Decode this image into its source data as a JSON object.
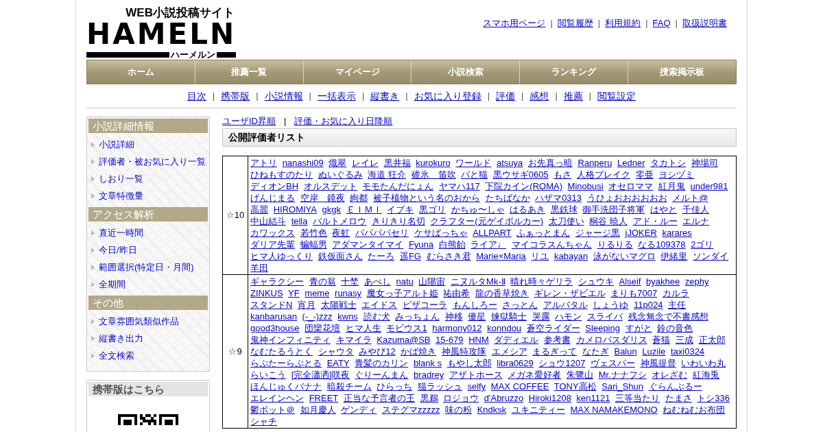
{
  "logo": {
    "tagline": "WEB小説投稿サイト",
    "name": "HAMELN",
    "reading": "ハーメルン"
  },
  "header_links": [
    {
      "label": "スマホ用ページ"
    },
    {
      "sep": "|",
      "label": "閲覧履歴"
    },
    {
      "sep": "|",
      "label": "利用規約"
    },
    {
      "sep": "|",
      "label": "FAQ"
    },
    {
      "sep": "|",
      "label": "取扱説明書"
    }
  ],
  "nav": [
    "ホーム",
    "推薦一覧",
    "マイページ",
    "小説検索",
    "ランキング",
    "捜索掲示板"
  ],
  "sub_nav": [
    {
      "label": "目次"
    },
    {
      "sep": "|",
      "label": "携帯版"
    },
    {
      "sep": "|",
      "label": "小説情報"
    },
    {
      "sep": "|",
      "label": "一括表示"
    },
    {
      "sep": "|",
      "label": "縦書き"
    },
    {
      "sep": "|",
      "label": "お気に入り登録"
    },
    {
      "sep": "|",
      "label": "評価"
    },
    {
      "sep": "|",
      "label": "感想"
    },
    {
      "sep": "|",
      "label": "推薦"
    },
    {
      "sep": "|",
      "label": "閲覧設定"
    }
  ],
  "sidebar": {
    "sections": [
      {
        "title": "小説詳細情報",
        "items": [
          "小説詳細",
          "評価者・被お気に入り一覧",
          "しおり一覧",
          "文章特徴量"
        ]
      },
      {
        "title": "アクセス解析",
        "items": [
          "直近一時間",
          "今日/昨日",
          "範囲選択(特定日・月間)",
          "全期間"
        ]
      },
      {
        "title": "その他",
        "items": [
          "文章雰囲気類似作品",
          "縦書き出力",
          "全文検索"
        ]
      }
    ],
    "mobile_box": {
      "title": "携帯版はこちら"
    }
  },
  "sort_links": [
    {
      "label": "ユーザID昇順"
    },
    {
      "sep": "|",
      "label": "評価・お気に入り日降順"
    }
  ],
  "list_title": "公開評価者リスト",
  "ratings": [
    {
      "rating": "☆10",
      "users": [
        "アトリ",
        "nanashi09",
        "熾翠",
        "レイレ",
        "黒井福",
        "kurokuro",
        "ワールド",
        "atsuya",
        "お先真っ暗",
        "Ranperu",
        "Ledner",
        "タカトシ",
        "神場司",
        "ひねもすのたり",
        "ぬいぐるみ",
        "海道 狂介",
        "碓氷　笛吹",
        "パと猫",
        "黒ウサギ0605",
        "もさ",
        "人格ブレイク",
        "零亜",
        "ヨシヅミ",
        "ディオンBH",
        "オルスデット",
        "モモたんだにょん",
        "ヤマハ117",
        "下院カイン(ROMA)",
        "Minobusi",
        "オセロママ",
        "紅月鬼",
        "under981",
        "げんじまる",
        "空岸　鏡夜",
        "絢都",
        "被子植物という名のおから",
        "たちばなか",
        "ハザマ0313",
        "うひょおおおおおお",
        "メルト@",
        "高麗",
        "HIROMIYA",
        "gkgk",
        "ＥＩＭＩ",
        "イブキ",
        "黒ゴリ",
        "かちゅ〜しゃ",
        "はるあき",
        "黒鉄球",
        "御手洗団子将軍",
        "はやと",
        "千佳人",
        "中山結斗",
        "tella",
        "バルトメロウ",
        "きりきり名切",
        "クラフター(元ゲイボルカー)",
        "太刀使い",
        "桐谷 暁人",
        "アド・ルー",
        "エルナ",
        "カワックス",
        "若竹色",
        "夜虹",
        "パパパパセリ",
        "ケサぱっちゃ",
        "ALLPART",
        "ふぁっとまん",
        "ジャージ黒",
        "jJOKER",
        "karares",
        "ダリア先輩",
        "蝙蝠男",
        "アダマンタイマイ",
        "Fyuna",
        "白熊飴",
        "ライア♩",
        "マイコラスんちゃん",
        "りるりる",
        "なる109378",
        "2ゴリ",
        "ヒマ人ゆっくり",
        "鉄仮面さん",
        "たーろ",
        "遥FG",
        "むらさき君",
        "Marie×Maria",
        "リユ",
        "kabayan",
        "泳がないマグロ",
        "伊緒里",
        "ソンダイ",
        "羊田"
      ]
    },
    {
      "rating": "☆9",
      "users": [
        "ギャラクシー",
        "青の翁",
        "十埜",
        "あべし",
        "natu",
        "山陽宙",
        "ニヌルタMk-Ⅱ",
        "晴れ時々ゲリラ",
        "シュウキ",
        "Alseif",
        "byakhee",
        "zephy",
        "ZINKUS",
        "YF",
        "meme",
        "runasy",
        "魔女っ子アルト姫",
        "祐由希",
        "龍の香草焼き",
        "ギレン・ザビエル",
        "まりも7007",
        "カルラ",
        "スタンドN",
        "宵月",
        "太陽戦士",
        "エイドス",
        "ピザコーラ",
        "もんしろー",
        "さっとん",
        "アルバタル",
        "しょうゆ",
        "11p024",
        "主任",
        "kanbarusan",
        "(-_-)zzz",
        "kwns",
        "読む犬",
        "みっちょん",
        "神移",
        "優星",
        "煉獄騎士",
        "哭露",
        "ハモン",
        "スライバ",
        "残念無念で不書感想",
        "good3house",
        "団欒花壇",
        "ヒマ人生",
        "モビウス1",
        "harmony012",
        "konndou",
        "蒼空ライダー",
        "Sleeping",
        "すがと",
        "鈴の音色",
        "鬼神インフィニティ",
        "キマイラ",
        "Kazuma@SB",
        "15-679",
        "HNM",
        "ダディエル",
        "参考書",
        "カメロパスダリス",
        "蒼猫",
        "三成",
        "正太郎",
        "なむたるうとく",
        "シャウタ",
        "みやび12",
        "かば焼き",
        "神風特攻隊",
        "エメシア",
        "まるぎって",
        "なたぎ",
        "Balun",
        "Luzile",
        "taxi0324",
        "らぷたーらぷとる",
        "EATY",
        "青髪のカリン",
        "blank s",
        "もやし太郎",
        "libra0629",
        "ショウ1207",
        "ヴェスパー",
        "神風提督",
        "いわいわ丸",
        "らいこう",
        "[完全瀟洒]咲夜",
        "ぐりーんまん",
        "bradrey",
        "アザトホース",
        "メガネ愛好者",
        "朱鷺山",
        "Mr.ナナフシ",
        "オレざむ",
        "紅海兎",
        "ほんじゅくバナナ",
        "暗殺チーム",
        "ひらっち",
        "猫ラッシュ",
        "selfy",
        "MAX COFFEE",
        "TONY高松",
        "Sari_Shun",
        "ぐらんぶるー",
        "エレインヘン",
        "FREET",
        "正当な予言者の王",
        "黒鵜",
        "ロジョウ",
        "d'Abruzzo",
        "Hiroki1208",
        "ken1121",
        "三等当たり",
        "たまさ",
        "トシ336",
        "鬱ボット＠",
        "如月慶人",
        "ゲンディ",
        "ステグマzzzzz",
        "味の粉",
        "Kndksk",
        "ユキニティー",
        "MAX NAMAKEMONO",
        "ねむねむお布団",
        "シャチ"
      ]
    }
  ]
}
